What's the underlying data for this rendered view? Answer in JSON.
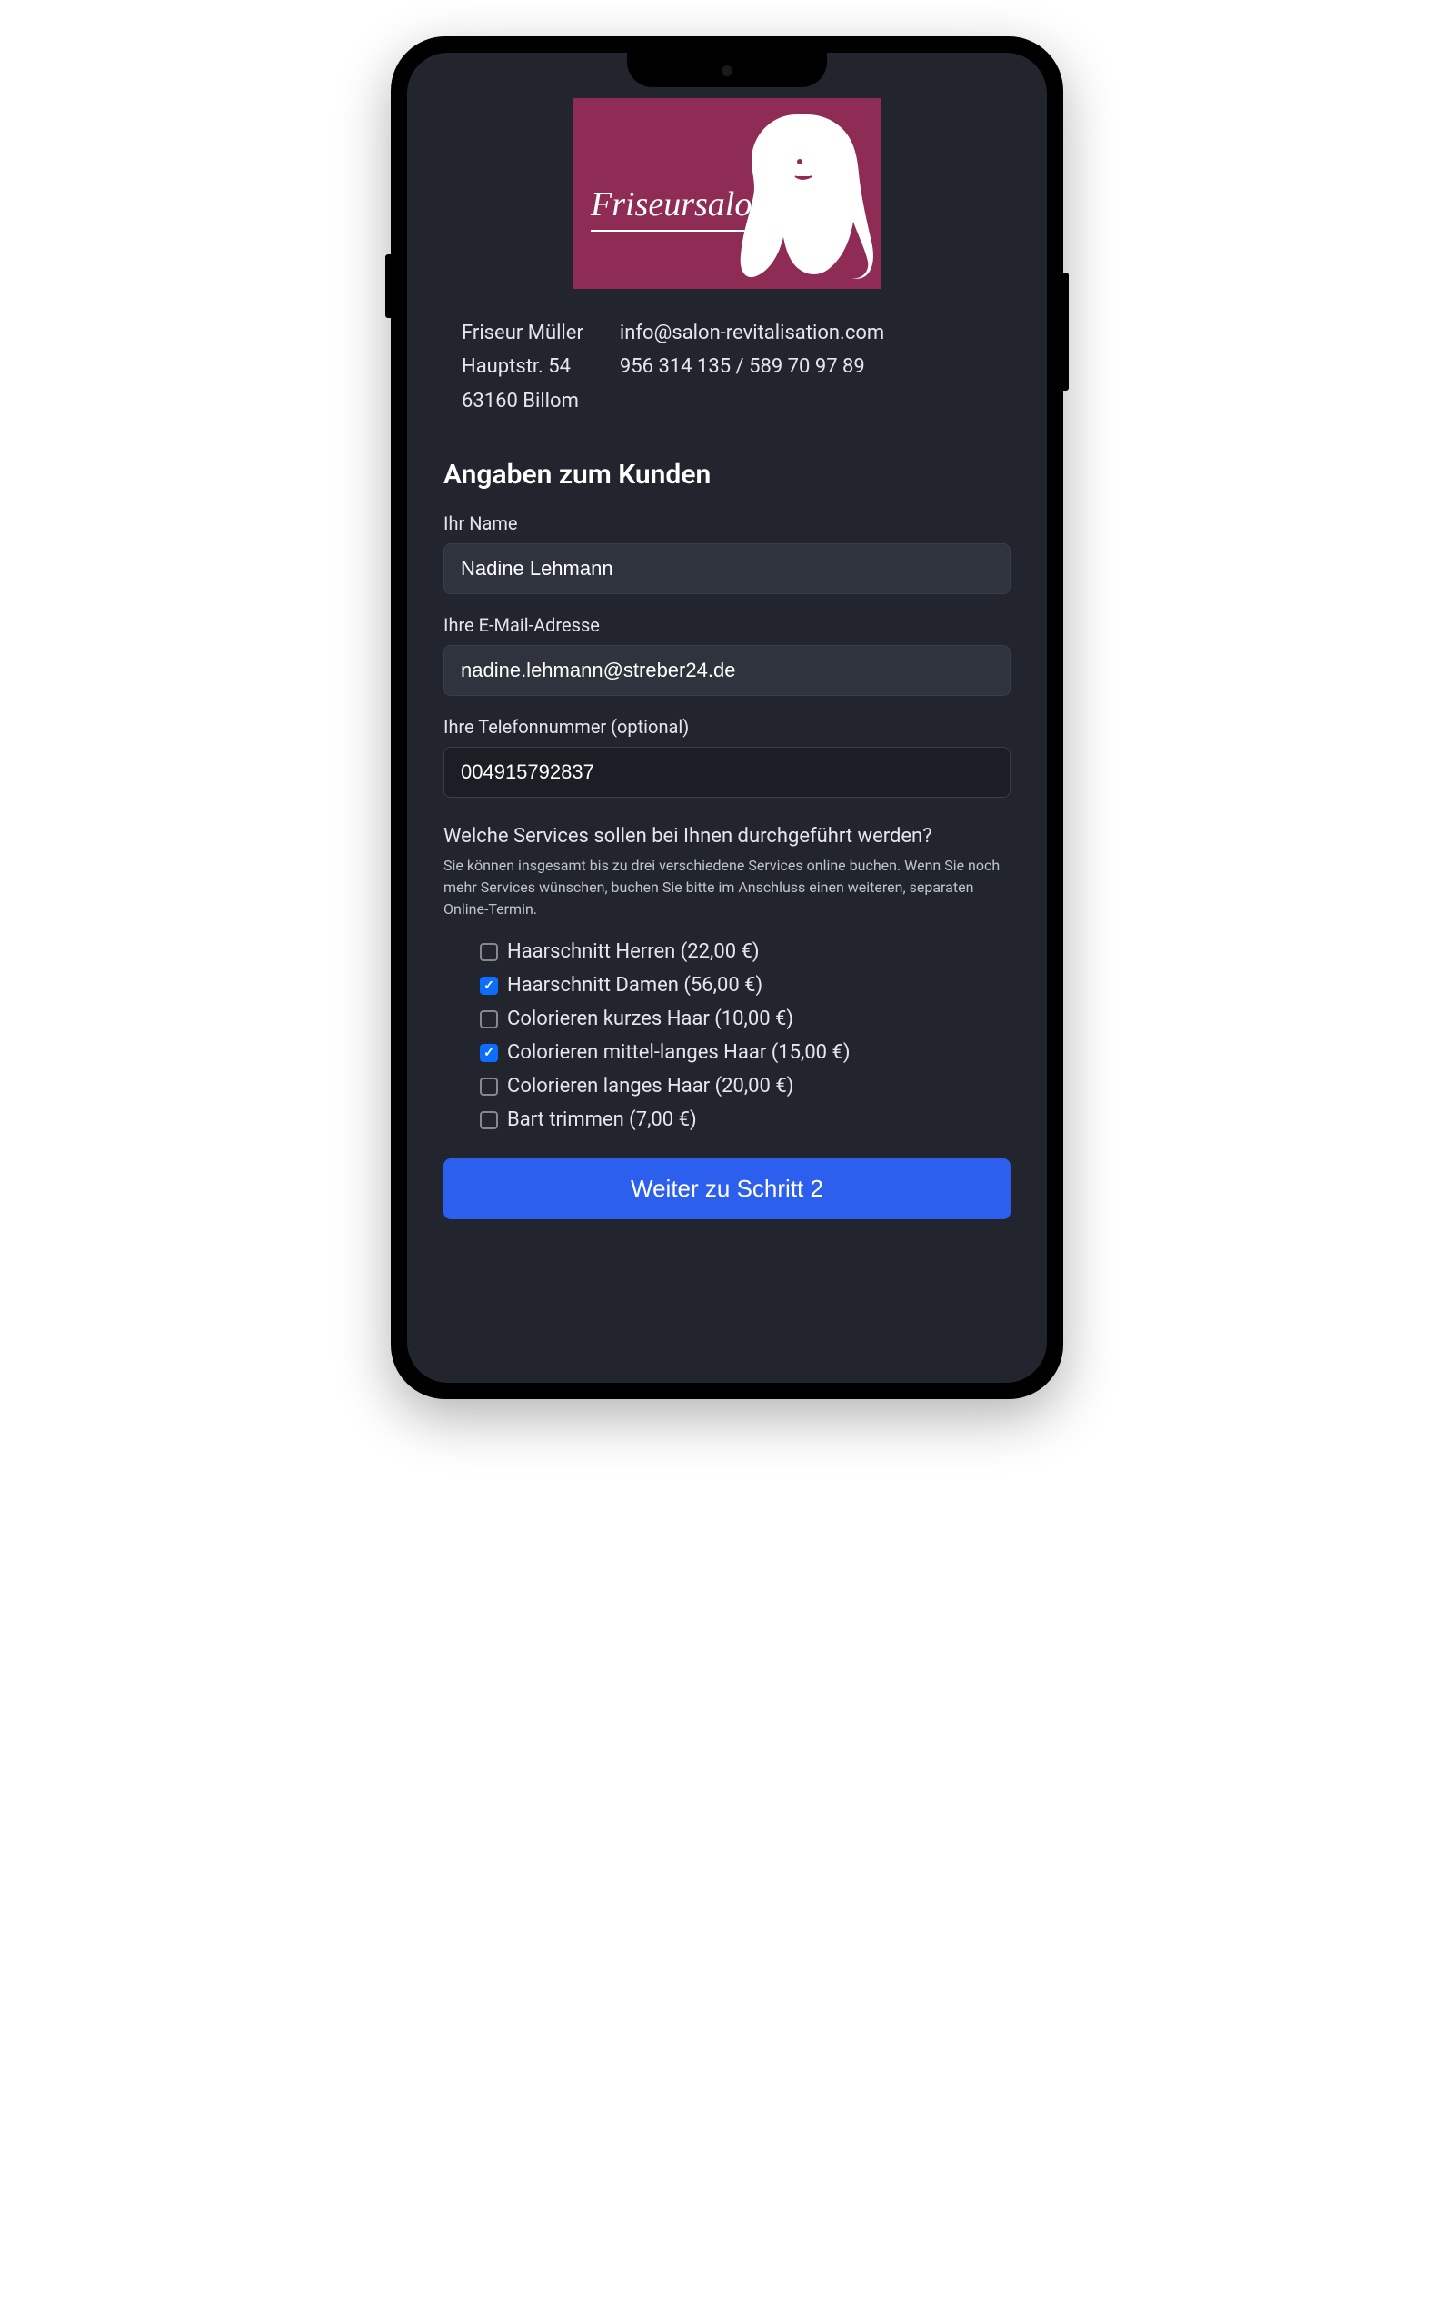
{
  "logo": {
    "brand_text": "Friseursalon"
  },
  "salon": {
    "name": "Friseur Müller",
    "street": "Hauptstr. 54",
    "city": "63160 Billom",
    "email": "info@salon-revitalisation.com",
    "phones": "956 314 135 / 589 70 97 89"
  },
  "section_title": "Angaben zum Kunden",
  "fields": {
    "name": {
      "label": "Ihr Name",
      "value": "Nadine Lehmann"
    },
    "email": {
      "label": "Ihre E-Mail-Adresse",
      "value": "nadine.lehmann@streber24.de"
    },
    "phone": {
      "label": "Ihre Telefonnummer (optional)",
      "value": "004915792837"
    }
  },
  "services": {
    "question": "Welche Services sollen bei Ihnen durchgeführt werden?",
    "hint": "Sie können insgesamt bis zu drei verschiedene Services online buchen. Wenn Sie noch mehr Services wünschen, buchen Sie bitte im Anschluss einen weiteren, separaten Online-Termin.",
    "items": [
      {
        "label": "Haarschnitt Herren (22,00 €)",
        "checked": false
      },
      {
        "label": "Haarschnitt Damen (56,00 €)",
        "checked": true
      },
      {
        "label": "Colorieren kurzes Haar (10,00 €)",
        "checked": false
      },
      {
        "label": "Colorieren mittel-langes Haar (15,00 €)",
        "checked": true
      },
      {
        "label": "Colorieren langes Haar (20,00 €)",
        "checked": false
      },
      {
        "label": "Bart trimmen (7,00 €)",
        "checked": false
      }
    ]
  },
  "cta": "Weiter zu Schritt 2",
  "colors": {
    "accent": "#8e2c55",
    "primary": "#2d5fef",
    "bg_dark": "#22252d"
  }
}
